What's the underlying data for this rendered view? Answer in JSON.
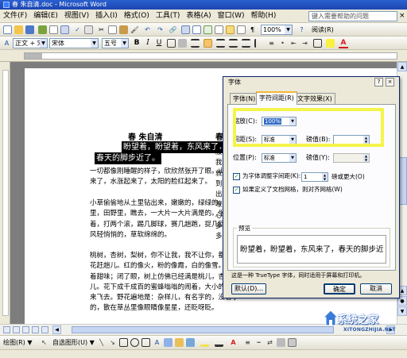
{
  "window": {
    "title": "春 朱自清.doc - Microsoft Word"
  },
  "menubar": {
    "items": [
      "文件(F)",
      "编辑(E)",
      "视图(V)",
      "插入(I)",
      "格式(O)",
      "工具(T)",
      "表格(A)",
      "窗口(W)",
      "帮助(H)"
    ],
    "help_search": "键入需要帮助的问题",
    "close": "×"
  },
  "toolbar1": {
    "zoom": "100%",
    "reading": "阅读(R)"
  },
  "toolbar2": {
    "style": "正文 + 宋体",
    "font": "宋体",
    "size": "五号",
    "bold": "B",
    "italic": "I",
    "underline": "U",
    "font_color_letter": "A"
  },
  "document": {
    "title": "春 朱自清",
    "title_partial": "春",
    "selected_lines": [
      "盼望着，盼望着，东风来了，",
      "春天的脚步近了。"
    ],
    "paragraphs": [
      "一切都像刚睡醒的样子，欣欣然张开了眼。山朗润起来了，水涨起来了，太阳的脸红起来了。",
      "小草偷偷地从土里钻出来，嫩嫩的，绿绿的。园子里，田野里，瞧去，一大片一大片满是的。坐着，躺着，打两个滚，踢几脚球，赛几趟跑，捉几回迷藏。风轻悄悄的，草软绵绵的。",
      "桃树，杏树，梨树，你不让我，我不让你，都开满了花赶趟儿。红的像火，粉的像霞，白的像雪。花里带着甜味；闭了眼，树上仿佛已经满是桃儿，杏儿，梨儿。花下成千成百的蜜蜂嗡嗡的闹着，大小的蝴蝶飞来飞去。野花遍地是：杂样儿，有名字的，没名字的，散在草丛里像眼睛像星星，还眨呀眨。"
    ],
    "right_column": [
      "腰肋",
      "我",
      "就是",
      "到顶",
      "出笑",
      "嘹亮",
      "心坎",
      "多少",
      "多少"
    ]
  },
  "dialog": {
    "title": "字体",
    "help": "?",
    "close": "×",
    "tabs": [
      "字体(N)",
      "字符间距(R)",
      "文字效果(X)"
    ],
    "active_tab": 1,
    "scale_label": "缩放(C):",
    "scale_value": "100%",
    "spacing_label": "间距(S):",
    "spacing_value": "标准",
    "spacing_by_label": "磅值(B):",
    "position_label": "位置(P):",
    "position_value": "标准",
    "position_by_label": "磅值(Y):",
    "kerning_label": "为字体调整字间距(K):",
    "kerning_value": "1",
    "kerning_unit": "磅或更大(O)",
    "grid_label": "如果定义了文档网格，则对齐网格(W)",
    "preview_label": "预览",
    "preview_text": "盼望着，盼望着，东风来了，春天的脚步近",
    "truetype_note": "这是一种 TrueType 字体，同时适用于屏幕和打印机。",
    "default_button": "默认(D)...",
    "ok_button": "确定",
    "cancel_button": "取消"
  },
  "drawbar": {
    "draw": "绘图(R) ▼",
    "autoshapes": "自选图形(U) ▼"
  },
  "watermark": {
    "text": "系统之家",
    "url": "XITONGZHIJIA.NET"
  }
}
